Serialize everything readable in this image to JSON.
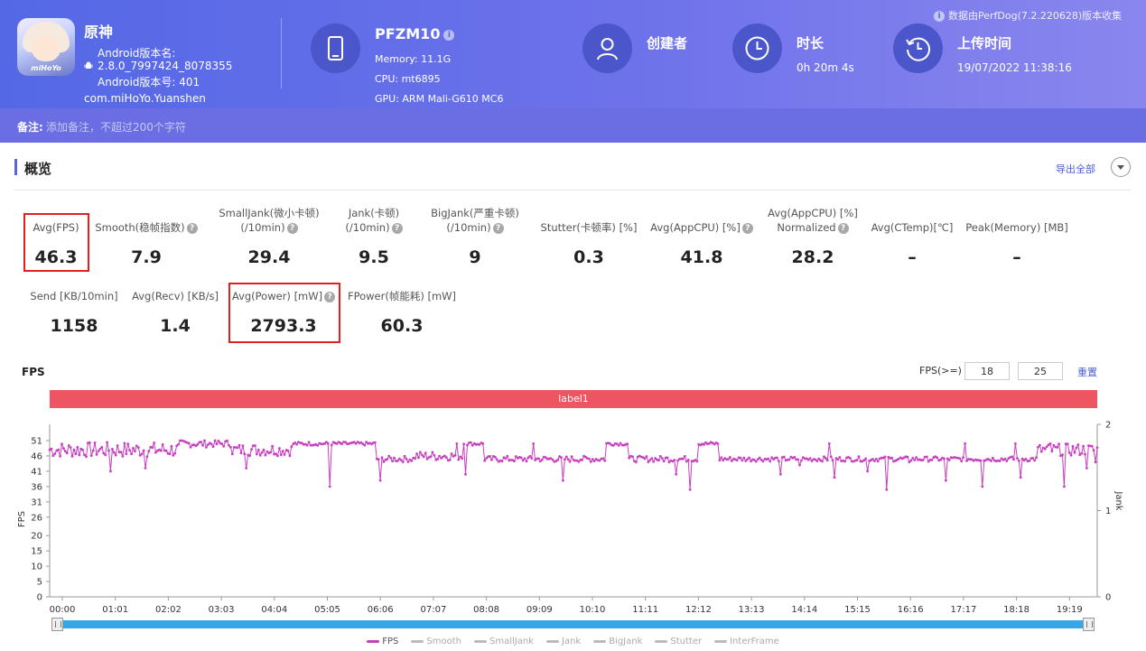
{
  "app": {
    "name": "原神",
    "icon_brand": "miHoYo",
    "version_label": "Android版本名:",
    "version_value": "2.8.0_7997424_8078355",
    "build_label": "Android版本号: 401",
    "package": "com.miHoYo.Yuanshen"
  },
  "device": {
    "name": "PFZM10",
    "memory": "Memory: 11.1G",
    "cpu": "CPU: mt6895",
    "gpu": "GPU: ARM Mali-G610 MC6"
  },
  "creator": {
    "title": "创建者"
  },
  "duration": {
    "title": "时长",
    "value": "0h 20m 4s"
  },
  "upload": {
    "title": "上传时间",
    "value": "19/07/2022 11:38:16"
  },
  "collected_note": "数据由PerfDog(7.2.220628)版本收集",
  "remark": {
    "label": "备注:",
    "placeholder": "添加备注，不超过200个字符"
  },
  "overview": {
    "title": "概览",
    "export_label": "导出全部",
    "metrics_row1": [
      {
        "label1": "",
        "label2": "Avg(FPS)",
        "value": "46.3",
        "help": false
      },
      {
        "label1": "",
        "label2": "Smooth(稳帧指数)",
        "value": "7.9",
        "help": true
      },
      {
        "label1": "SmallJank(微小卡顿)",
        "label2": "(/10min)",
        "value": "29.4",
        "help": true
      },
      {
        "label1": "Jank(卡顿)",
        "label2": "(/10min)",
        "value": "9.5",
        "help": true
      },
      {
        "label1": "BigJank(严重卡顿)",
        "label2": "(/10min)",
        "value": "9",
        "help": true
      },
      {
        "label1": "",
        "label2": "Stutter(卡顿率) [%]",
        "value": "0.3",
        "help": false
      },
      {
        "label1": "",
        "label2": "Avg(AppCPU) [%]",
        "value": "41.8",
        "help": true
      },
      {
        "label1": "Avg(AppCPU) [%]",
        "label2": "Normalized",
        "value": "28.2",
        "help": true
      },
      {
        "label1": "",
        "label2": "Avg(CTemp)[℃]",
        "value": "–",
        "help": false
      },
      {
        "label1": "",
        "label2": "Peak(Memory) [MB]",
        "value": "–",
        "help": false
      }
    ],
    "metrics_row2": [
      {
        "label": "Send [KB/10min]",
        "value": "1158",
        "help": false
      },
      {
        "label": "Avg(Recv) [KB/s]",
        "value": "1.4",
        "help": false
      },
      {
        "label": "Avg(Power) [mW]",
        "value": "2793.3",
        "help": true
      },
      {
        "label": "FPower(帧能耗) [mW]",
        "value": "60.3",
        "help": false
      }
    ]
  },
  "fps_panel": {
    "title": "FPS",
    "threshold_label": "FPS(>=)",
    "threshold_low": "18",
    "threshold_high": "25",
    "reset_label": "重置",
    "band_label": "label1"
  },
  "colors": {
    "fps_series": "#c83fc0",
    "band": "#ee5563",
    "slider": "#36a6e6",
    "header": "#5a66df"
  },
  "chart_data": {
    "type": "line",
    "ylabel": "FPS",
    "y2label": "Jank",
    "ylim": [
      0,
      51
    ],
    "y2lim": [
      0,
      2
    ],
    "yticks": [
      0,
      5,
      10,
      15,
      20,
      26,
      31,
      36,
      41,
      46,
      51
    ],
    "y2ticks": [
      0,
      1,
      2
    ],
    "x_tick_labels": [
      "00:00",
      "01:01",
      "02:02",
      "03:03",
      "04:04",
      "05:05",
      "06:06",
      "07:07",
      "08:08",
      "09:09",
      "10:10",
      "11:11",
      "12:12",
      "13:13",
      "14:14",
      "15:15",
      "16:16",
      "17:17",
      "18:18",
      "19:19"
    ],
    "duration_seconds": 1204,
    "grid": false,
    "legend_position": "bottom",
    "legend": [
      "FPS",
      "Smooth",
      "SmallJank",
      "Jank",
      "BigJank",
      "Stutter",
      "InterFrame"
    ],
    "series": [
      {
        "name": "FPS",
        "segments": [
          {
            "t": [
              0,
              150
            ],
            "level": 48,
            "noise": 2.5
          },
          {
            "t": [
              150,
              210
            ],
            "level": 50,
            "noise": 1.2
          },
          {
            "t": [
              210,
              280
            ],
            "level": 48,
            "noise": 2
          },
          {
            "t": [
              280,
              375
            ],
            "level": 50,
            "noise": 0.6
          },
          {
            "t": [
              375,
              420
            ],
            "level": 45,
            "noise": 1
          },
          {
            "t": [
              420,
              475
            ],
            "level": 46,
            "noise": 1.5
          },
          {
            "t": [
              475,
              500
            ],
            "level": 50,
            "noise": 0.6
          },
          {
            "t": [
              500,
              640
            ],
            "level": 45,
            "noise": 1
          },
          {
            "t": [
              640,
              665
            ],
            "level": 50,
            "noise": 0.6
          },
          {
            "t": [
              665,
              745
            ],
            "level": 45,
            "noise": 1
          },
          {
            "t": [
              745,
              770
            ],
            "level": 50,
            "noise": 0.6
          },
          {
            "t": [
              770,
              1135
            ],
            "level": 45,
            "noise": 0.8
          },
          {
            "t": [
              1135,
              1204
            ],
            "level": 48,
            "noise": 2
          }
        ],
        "dips": [
          [
            70,
            41
          ],
          [
            110,
            42
          ],
          [
            225,
            42
          ],
          [
            322,
            36
          ],
          [
            380,
            38
          ],
          [
            477,
            40
          ],
          [
            555,
            39
          ],
          [
            590,
            38
          ],
          [
            720,
            40
          ],
          [
            736,
            35
          ],
          [
            840,
            40
          ],
          [
            862,
            43
          ],
          [
            902,
            39
          ],
          [
            940,
            41
          ],
          [
            962,
            35
          ],
          [
            988,
            44
          ],
          [
            1030,
            38
          ],
          [
            1072,
            36
          ],
          [
            1115,
            39
          ],
          [
            1165,
            36
          ],
          [
            1192,
            42
          ],
          [
            1202,
            44
          ]
        ],
        "peaks": [
          [
            468,
            50
          ],
          [
            555,
            50
          ],
          [
            895,
            50
          ],
          [
            1052,
            50
          ],
          [
            1110,
            50
          ],
          [
            1150,
            50
          ]
        ]
      }
    ]
  }
}
